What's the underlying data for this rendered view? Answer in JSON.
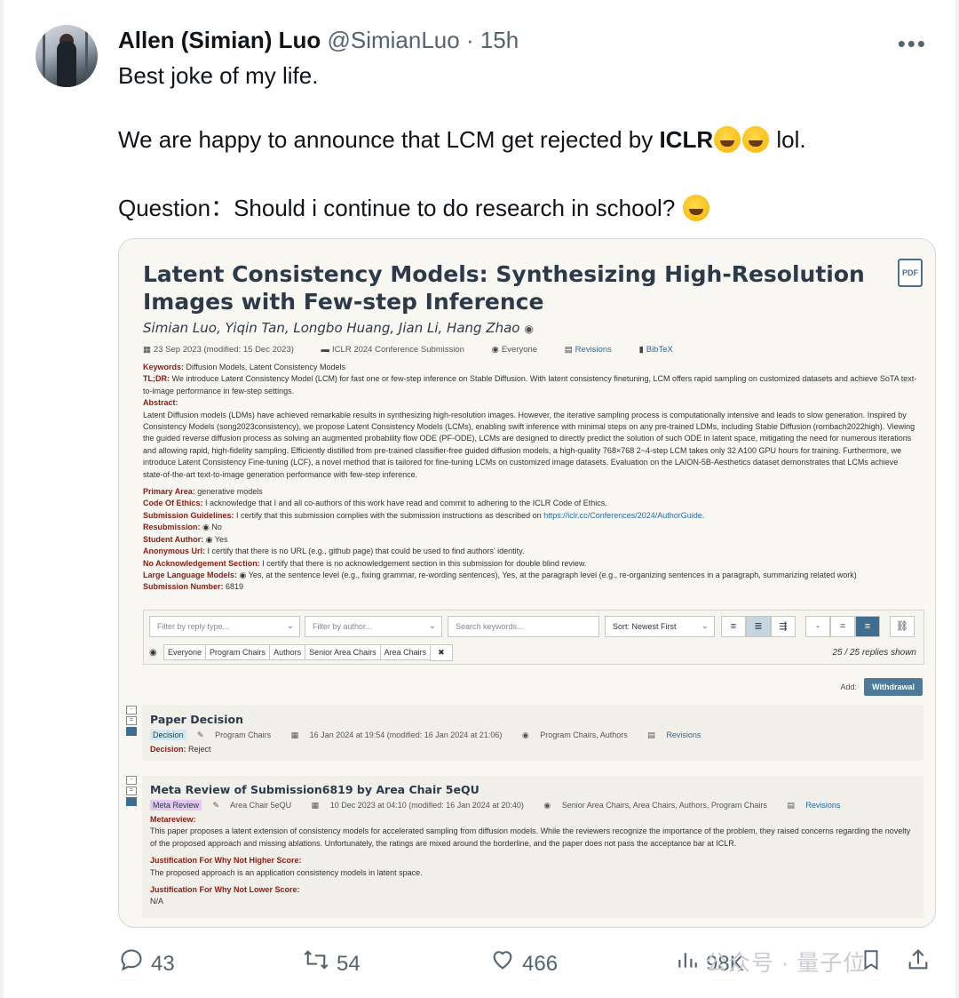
{
  "tweet": {
    "name": "Allen (Simian) Luo",
    "handle": "@SimianLuo · 15h",
    "line1": "Best joke of my life.",
    "line2_pre": "We are happy to announce that LCM get rejected by ",
    "line2_bold": "ICLR",
    "line2_post": " lol.",
    "line3": "Question：Should i continue to do research in school?",
    "emoji_laugh": "rolling-on-floor-laughing",
    "emoji_grin": "grinning-face"
  },
  "paper": {
    "title": "Latent Consistency Models: Synthesizing High-Resolution Images with Few-step Inference",
    "pdf_label": "PDF",
    "authors": "Simian Luo, Yiqin Tan, Longbo Huang, Jian Li, Hang Zhao",
    "date": "23 Sep 2023 (modified: 15 Dec 2023)",
    "venue": "ICLR 2024 Conference Submission",
    "readers": "Everyone",
    "revisions": "Revisions",
    "bibtex": "BibTeX",
    "keywords_label": "Keywords:",
    "keywords": "Diffusion Models, Latent Consistency Models",
    "tldr_label": "TL;DR:",
    "tldr": "We introduce Latent Consistency Model (LCM) for fast one or few-step inference on Stable Diffusion. With latent consistency finetuning, LCM offers rapid sampling on customized datasets and achieve SoTA text-to-image performance in few-step settings.",
    "abstract_label": "Abstract:",
    "abstract": "Latent Diffusion models (LDMs) have achieved remarkable results in synthesizing high-resolution images. However, the iterative sampling process is computationally intensive and leads to slow generation. Inspired by Consistency Models (song2023consistency), we propose Latent Consistency Models (LCMs), enabling swift inference with minimal steps on any pre-trained LDMs, including Stable Diffusion (rombach2022high). Viewing the guided reverse diffusion process as solving an augmented probability flow ODE (PF-ODE), LCMs are designed to directly predict the solution of such ODE in latent space, mitigating the need for numerous iterations and allowing rapid, high-fidelity sampling. Efficiently distilled from pre-trained classifier-free guided diffusion models, a high-quality 768×768 2~4-step LCM takes only 32 A100 GPU hours for training. Furthermore, we introduce Latent Consistency Fine-tuning (LCF), a novel method that is tailored for fine-tuning LCMs on customized image datasets. Evaluation on the LAION-5B-Aesthetics dataset demonstrates that LCMs achieve state-of-the-art text-to-image generation performance with few-step inference.",
    "primary_area_label": "Primary Area:",
    "primary_area": "generative models",
    "ethics_label": "Code Of Ethics:",
    "ethics": "I acknowledge that I and all co-authors of this work have read and commit to adhering to the ICLR Code of Ethics.",
    "guidelines_label": "Submission Guidelines:",
    "guidelines": "I certify that this submission complies with the submission instructions as described on ",
    "guidelines_link": "https://iclr.cc/Conferences/2024/AuthorGuide",
    "resubmission_label": "Resubmission:",
    "resubmission": "No",
    "student_label": "Student Author:",
    "student": "Yes",
    "anon_label": "Anonymous Url:",
    "anon": "I certify that there is no URL (e.g., github page) that could be used to find authors' identity.",
    "noack_label": "No Acknowledgement Section:",
    "noack": "I certify that there is no acknowledgement section in this submission for double blind review.",
    "llm_label": "Large Language Models:",
    "llm": "Yes, at the sentence level (e.g., fixing grammar, re-wording sentences), Yes, at the paragraph level (e.g., re-organizing sentences in a paragraph, summarizing related work)",
    "subnum_label": "Submission Number:",
    "subnum": "6819"
  },
  "filters": {
    "reply_type_placeholder": "Filter by reply type...",
    "author_placeholder": "Filter by author...",
    "search_placeholder": "Search keywords...",
    "sort": "Sort: Newest First",
    "chips": [
      "Everyone",
      "Program Chairs",
      "Authors",
      "Senior Area Chairs",
      "Area Chairs"
    ],
    "clear": "✖",
    "shown": "25 / 25 replies shown",
    "view_buttons": [
      "≡",
      "≣",
      "⇶"
    ],
    "zoom_buttons": [
      "-",
      "=",
      "≡"
    ],
    "link_icon": "⛓"
  },
  "add": {
    "label": "Add:",
    "button": "Withdrawal"
  },
  "decision": {
    "title": "Paper Decision",
    "tag": "Decision",
    "by": "Program Chairs",
    "date": "16 Jan 2024 at 19:54 (modified: 16 Jan 2024 at 21:06)",
    "readers": "Program Chairs, Authors",
    "revisions": "Revisions",
    "field_label": "Decision:",
    "field": "Reject"
  },
  "meta_review": {
    "title": "Meta Review of Submission6819 by Area Chair 5eQU",
    "tag": "Meta Review",
    "by": "Area Chair 5eQU",
    "date": "10 Dec 2023 at 04:10 (modified: 16 Jan 2024 at 20:40)",
    "readers": "Senior Area Chairs, Area Chairs, Authors, Program Chairs",
    "revisions": "Revisions",
    "metareview_label": "Metareview:",
    "metareview": "This paper proposes a latent extension of consistency models for accelerated sampling from diffusion models. While the reviewers recognize the importance of the problem, they raised concerns regarding the novelty of the proposed approach and missing ablations. Unfortunately, the ratings are mixed around the borderline, and the paper does not pass the acceptance bar at ICLR.",
    "higher_label": "Justification For Why Not Higher Score:",
    "higher": "The proposed approach is an application consistency models in latent space.",
    "lower_label": "Justification For Why Not Lower Score:",
    "lower": "N/A"
  },
  "actions": {
    "replies": "43",
    "retweets": "54",
    "likes": "466",
    "views": "98K"
  },
  "watermark": "公众号 · 量子位"
}
